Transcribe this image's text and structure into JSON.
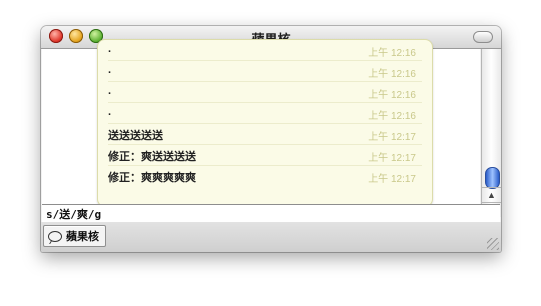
{
  "window": {
    "title": "蘋果核"
  },
  "chat": {
    "messages": [
      {
        "text": ".",
        "time": "上午 12:16"
      },
      {
        "text": ".",
        "time": "上午 12:16"
      },
      {
        "text": ".",
        "time": "上午 12:16"
      },
      {
        "text": ".",
        "time": "上午 12:16"
      },
      {
        "text": "送送送送送",
        "time": "上午 12:17"
      },
      {
        "text": "修正：爽送送送送",
        "time": "上午 12:17"
      },
      {
        "text": "修正：爽爽爽爽爽",
        "time": "上午 12:17"
      }
    ]
  },
  "input": {
    "value": "s/送/爽/g"
  },
  "tabs": [
    {
      "label": "蘋果核"
    }
  ],
  "colors": {
    "bubble_bg": "#fbfbe7",
    "time_text": "#c9c88a",
    "scroll_thumb": "#2a5cc9"
  },
  "icons": {
    "tab": "speech-bubble-icon",
    "scroll_up": "arrow-up-icon",
    "scroll_down": "arrow-down-icon"
  }
}
